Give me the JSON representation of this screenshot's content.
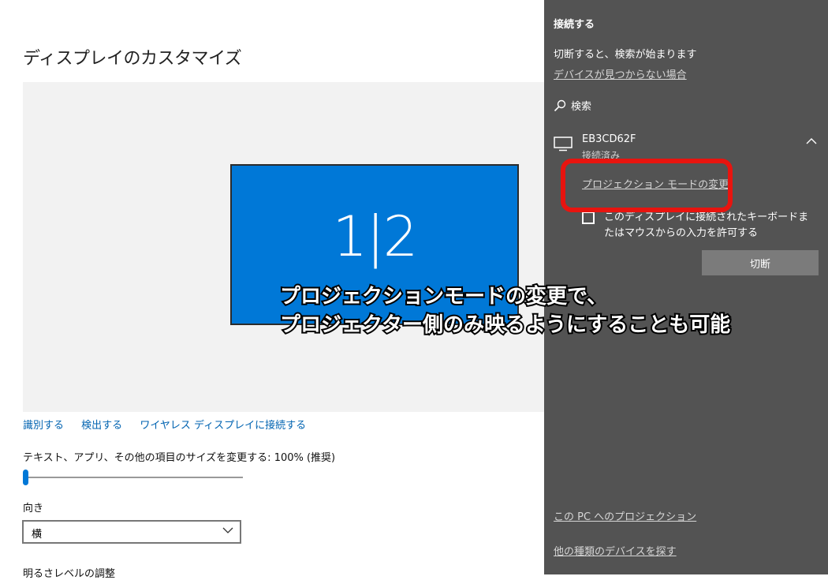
{
  "settings": {
    "title": "ディスプレイのカスタマイズ",
    "monitor_label": "1|2",
    "links": {
      "identify": "識別する",
      "detect": "検出する",
      "wireless": "ワイヤレス ディスプレイに接続する"
    },
    "scale_label": "テキスト、アプリ、その他の項目のサイズを変更する: 100% (推奨)",
    "scale_value_percent": 100,
    "orientation_label": "向き",
    "orientation_value": "横",
    "brightness_label": "明るさレベルの調整"
  },
  "connect_panel": {
    "title": "接続する",
    "message": "切断すると、検索が始まります",
    "not_found_link": "デバイスが見つからない場合",
    "search_label": "検索",
    "device": {
      "name": "EB3CD62F",
      "status": "接続済み",
      "projection_mode_link": "プロジェクション モードの変更",
      "allow_input_label": "このディスプレイに接続されたキーボードまたはマウスからの入力を許可する",
      "allow_input_checked": false,
      "disconnect_label": "切断"
    },
    "project_to_pc_link": "この PC へのプロジェクション",
    "find_other_link": "他の種類のデバイスを探す"
  },
  "annotation": {
    "line1": "プロジェクションモードの変更で、",
    "line2": "プロジェクター側のみ映るようにすることも可能",
    "highlight_color": "#e8140f"
  },
  "colors": {
    "accent": "#0078d7",
    "panel_bg": "#535353"
  }
}
